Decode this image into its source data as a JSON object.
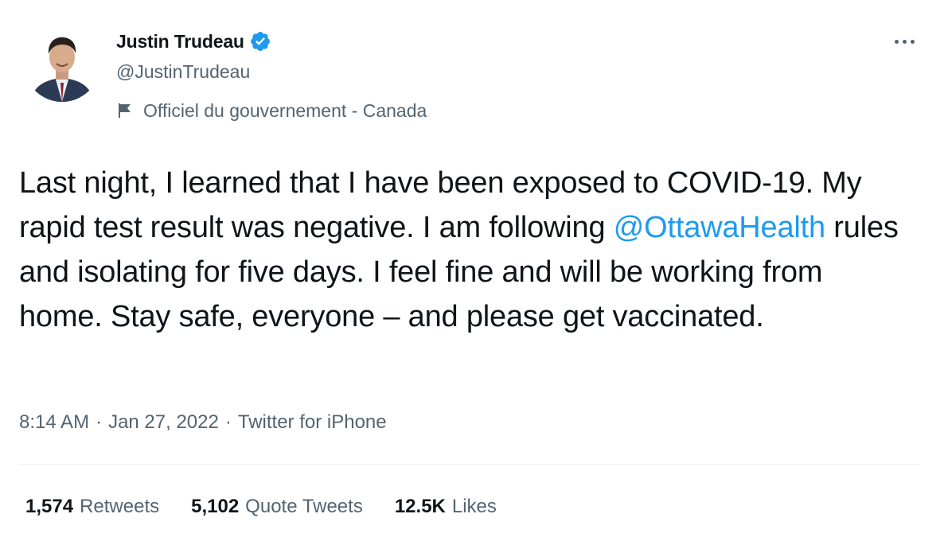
{
  "tweet": {
    "author": {
      "display_name": "Justin Trudeau",
      "handle": "@JustinTrudeau",
      "verified": true,
      "label": "Officiel du gouvernement - Canada"
    },
    "text_parts": {
      "before_mention": "Last night, I learned that I have been exposed to COVID-19. My rapid test result was negative. I am following ",
      "mention": "@OttawaHealth",
      "after_mention": " rules and isolating for five days. I feel fine and will be working from home. Stay safe, everyone – and please get vaccinated."
    },
    "meta": {
      "time": "8:14 AM",
      "separator": "·",
      "date": "Jan 27, 2022",
      "source": "Twitter for iPhone"
    },
    "stats": {
      "retweets_count": "1,574",
      "retweets_label": "Retweets",
      "quotes_count": "5,102",
      "quotes_label": "Quote Tweets",
      "likes_count": "12.5K",
      "likes_label": "Likes"
    }
  },
  "icons": {
    "verified": "verified-badge-icon",
    "label": "flag-icon",
    "more": "more-horizontal-icon"
  },
  "colors": {
    "text_primary": "#0f1419",
    "text_secondary": "#536471",
    "accent": "#1d9bf0",
    "divider": "#eff3f4"
  }
}
